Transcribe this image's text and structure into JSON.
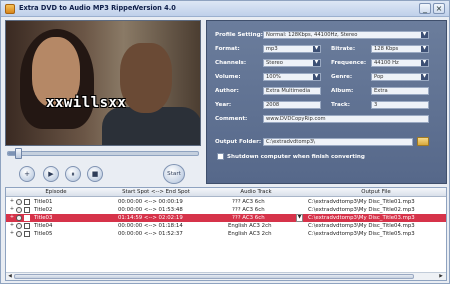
{
  "window": {
    "title": "Extra DVD to Audio MP3 Ripper",
    "version": "Version 4.0",
    "buttons": {
      "minimize": "_",
      "close": "×"
    }
  },
  "video": {
    "watermark": "xxwillsxx",
    "progress": 0.04
  },
  "controls": {
    "add": "+",
    "play": "▶",
    "pause": "⏸",
    "stop": "■",
    "start": "Start"
  },
  "settings": {
    "profile_label": "Profile Setting:",
    "profile_value": "Normal: 128Kbps, 44100Hz, Stereo",
    "format_label": "Format:",
    "format_value": "mp3",
    "bitrate_label": "Bitrate:",
    "bitrate_value": "128 Kbps",
    "channels_label": "Channels:",
    "channels_value": "Stereo",
    "frequence_label": "Frequence:",
    "frequence_value": "44100 Hz",
    "volume_label": "Volume:",
    "volume_value": "100%",
    "genre_label": "Genre:",
    "genre_value": "Pop",
    "author_label": "Author:",
    "author_value": "Extra Multimedia",
    "album_label": "Album:",
    "album_value": "Extra",
    "year_label": "Year:",
    "year_value": "2008",
    "track_label": "Track:",
    "track_value": "3",
    "comment_label": "Comment:",
    "comment_value": "www.DVDCopyRip.com",
    "output_label": "Output Folder:",
    "output_value": "C:\\extradvdtomp3\\",
    "shutdown_label": "Shutdown computer when finish converting"
  },
  "table": {
    "headers": [
      "Episode",
      "Start Spot <--> End Spot",
      "Audio Track",
      "Output File"
    ],
    "rows": [
      {
        "episode": "Title01",
        "spot": "00:00:00 <--> 00:00:19",
        "audio": "??? AC3  6ch",
        "output": "C:\\extradvdtomp3\\My Disc_Title01.mp3",
        "selected": false
      },
      {
        "episode": "Title02",
        "spot": "00:00:00 <--> 01:53:48",
        "audio": "??? AC3  6ch",
        "output": "C:\\extradvdtomp3\\My Disc_Title02.mp3",
        "selected": false
      },
      {
        "episode": "Title03",
        "spot": "01:14:59 <--> 02:02:19",
        "audio": "??? AC3  6ch",
        "output": "C:\\extradvdtomp3\\My Disc_Title03.mp3",
        "selected": true
      },
      {
        "episode": "Title04",
        "spot": "00:00:00 <--> 01:18:14",
        "audio": "English AC3  2ch",
        "output": "C:\\extradvdtomp3\\My Disc_Title04.mp3",
        "selected": false
      },
      {
        "episode": "Title05",
        "spot": "00:00:00 <--> 01:52:37",
        "audio": "English AC3  2ch",
        "output": "C:\\extradvdtomp3\\My Disc_Title05.mp3",
        "selected": false
      }
    ]
  },
  "colors": {
    "panel": "#5e7092",
    "selected_row": "#d6334a",
    "window_bg": "#e9edf3"
  }
}
